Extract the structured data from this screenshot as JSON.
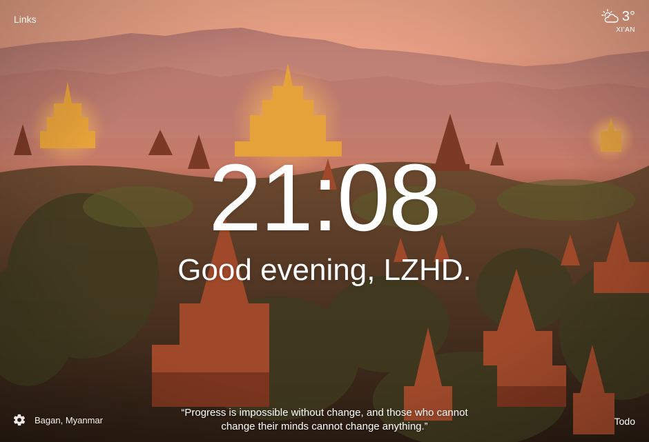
{
  "top_left": {
    "links_label": "Links"
  },
  "weather": {
    "icon": "partly-cloudy-night-icon",
    "temperature": "3°",
    "location": "XI'AN"
  },
  "center": {
    "time": "21:08",
    "greeting": "Good evening, LZHD."
  },
  "bottom_left": {
    "settings_icon": "gear-icon",
    "photo_location": "Bagan, Myanmar"
  },
  "quote": {
    "line1": "“Progress is impossible without change, and those who cannot",
    "line2": "change their minds cannot change anything.”"
  },
  "bottom_right": {
    "todo_label": "Todo"
  },
  "colors": {
    "text": "#ffffff",
    "sky_top": "#f0a88a",
    "haze": "#c67566",
    "ground": "#2a1f14",
    "temple_gold": "#e8a33a"
  }
}
